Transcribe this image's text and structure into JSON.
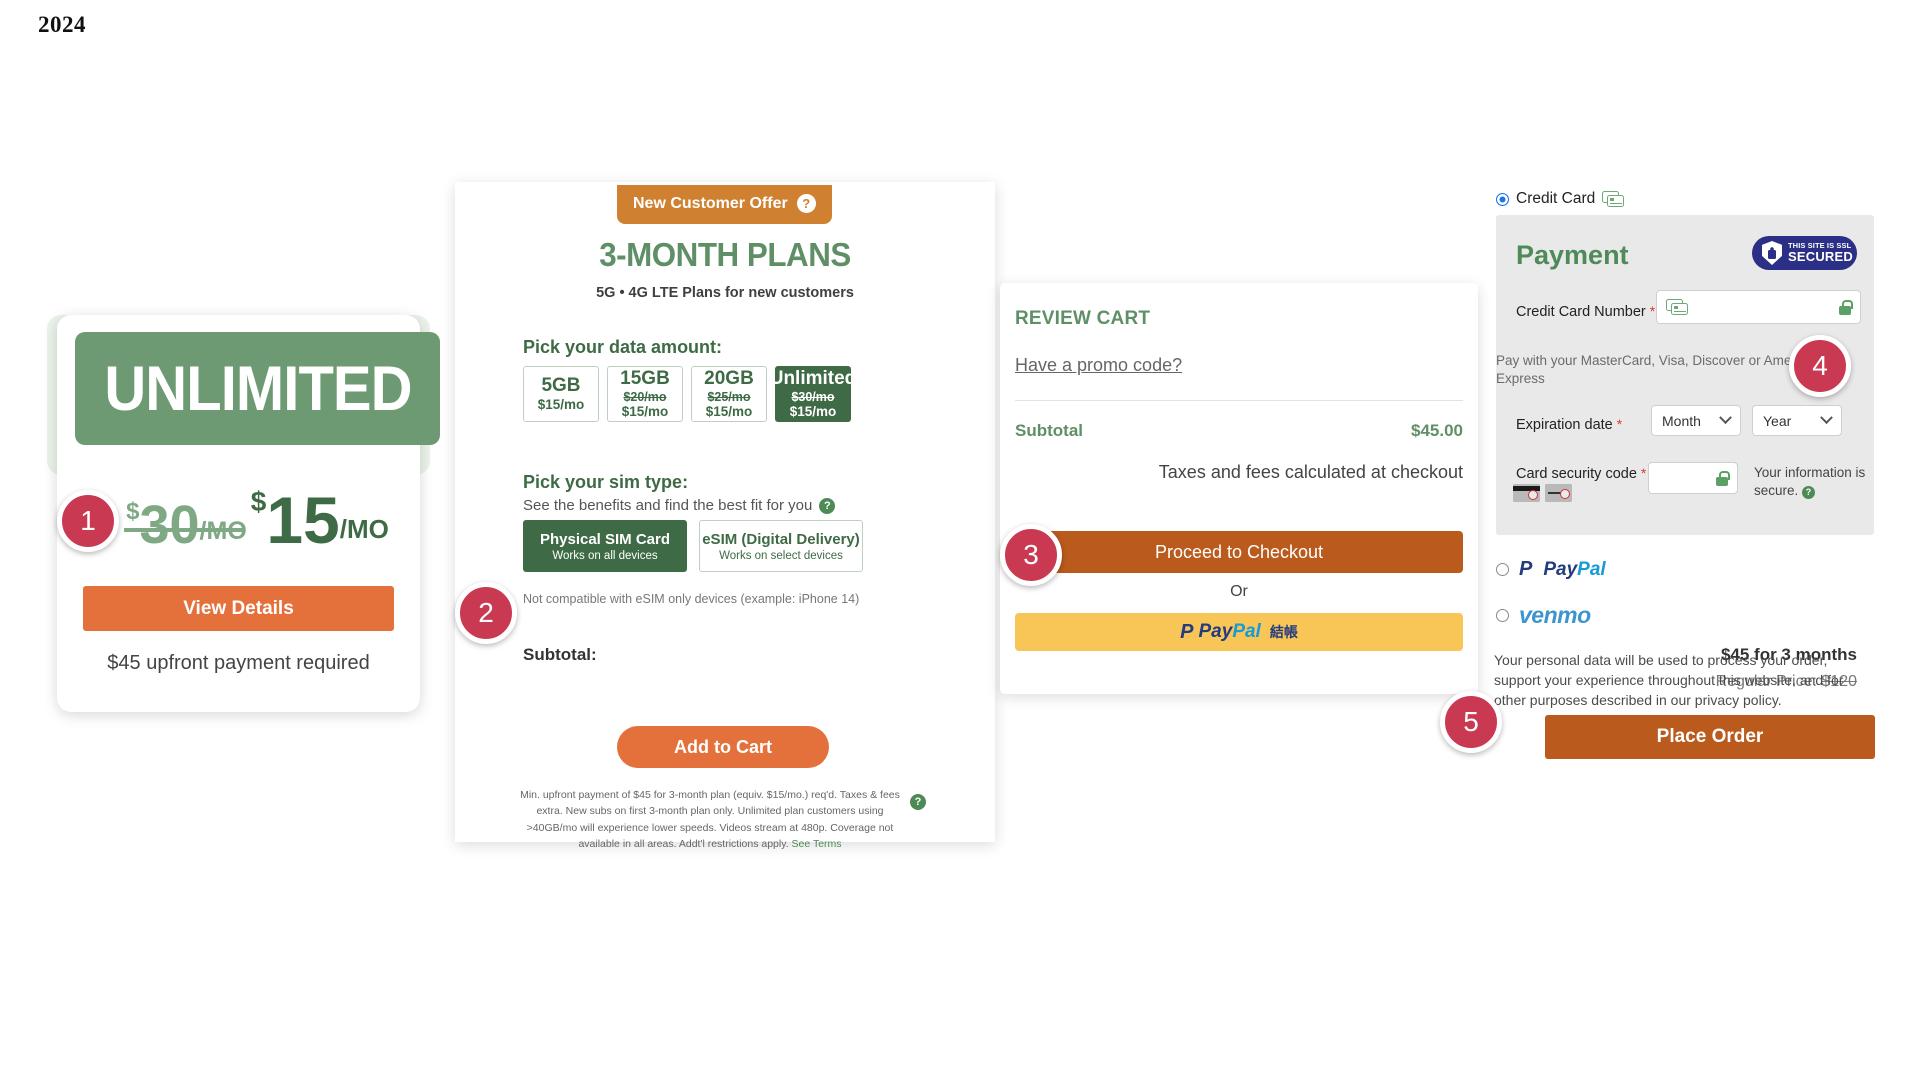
{
  "year": "2024",
  "steps": {
    "one": "1",
    "two": "2",
    "three": "3",
    "four": "4",
    "five": "5"
  },
  "panel1": {
    "plan_name": "UNLIMITED",
    "old_dollar": "$",
    "old_amount": "30",
    "old_per": "/MO",
    "new_dollar": "$",
    "new_amount": "15",
    "new_per": "/MO",
    "cta": "View Details",
    "note": "$45 upfront payment required"
  },
  "panel2": {
    "offer_badge": "New Customer Offer",
    "offer_help_icon": "question-icon",
    "title": "3-MONTH PLANS",
    "subtitle": "5G • 4G LTE Plans for new customers",
    "data_label": "Pick your data amount:",
    "data_options": [
      {
        "size": "5GB",
        "was": "",
        "now": "$15/mo",
        "selected": false
      },
      {
        "size": "15GB",
        "was": "$20/mo",
        "now": "$15/mo",
        "selected": false
      },
      {
        "size": "20GB",
        "was": "$25/mo",
        "now": "$15/mo",
        "selected": false
      },
      {
        "size": "Unlimited",
        "was": "$30/mo",
        "now": "$15/mo",
        "selected": true
      }
    ],
    "sim_label": "Pick your sim type:",
    "sim_sub": "See the benefits and find the best fit for you",
    "sim_options": [
      {
        "title": "Physical SIM Card",
        "sub": "Works on all devices",
        "selected": true
      },
      {
        "title": "eSIM (Digital Delivery)",
        "sub": "Works on select devices",
        "selected": false
      }
    ],
    "sim_note": "Not compatible with eSIM only devices (example: iPhone 14)",
    "subtotal_label": "Subtotal:",
    "subtotal_value": "$45 for 3 months",
    "regular_price_label": "Regular Price: ",
    "regular_price_value": "$120",
    "add_to_cart": "Add to Cart",
    "fine_print": "Min. upfront payment of $45 for 3-month plan (equiv. $15/mo.) req'd. Taxes & fees extra. New subs on first 3-month plan only. Unlimited plan customers using >40GB/mo will experience lower speeds. Videos stream at 480p. Coverage not available in all areas. Addt'l restrictions apply. ",
    "fine_print_link": "See Terms"
  },
  "panel3": {
    "title": "REVIEW CART",
    "promo_link": "Have a promo code?",
    "subtotal_label": "Subtotal",
    "subtotal_value": "$45.00",
    "taxes_note": "Taxes and fees calculated at checkout",
    "checkout_button": "Proceed to Checkout",
    "or": "Or",
    "paypal_pay": "Pay",
    "paypal_pal": "Pal",
    "paypal_cn": "結帳"
  },
  "panel4": {
    "credit_card_label": "Credit Card",
    "payment_heading": "Payment",
    "ssl_line1": "THIS SITE IS SSL",
    "ssl_line2": "SECURED",
    "cc_number_label": "Credit Card Number",
    "required_mark": "*",
    "pay_with_note": "Pay with your MasterCard, Visa, Discover or American Express",
    "expiration_label": "Expiration date",
    "month_select": "Month",
    "year_select": "Year",
    "cvv_label": "Card security code",
    "secure_note": "Your information is secure.",
    "paypal_pay": "Pay",
    "paypal_pal": "Pal",
    "venmo_label": "venmo",
    "privacy": "Your personal data will be used to process your order, support your experience throughout this website, and for other purposes described in our privacy policy.",
    "place_order": "Place Order"
  }
}
